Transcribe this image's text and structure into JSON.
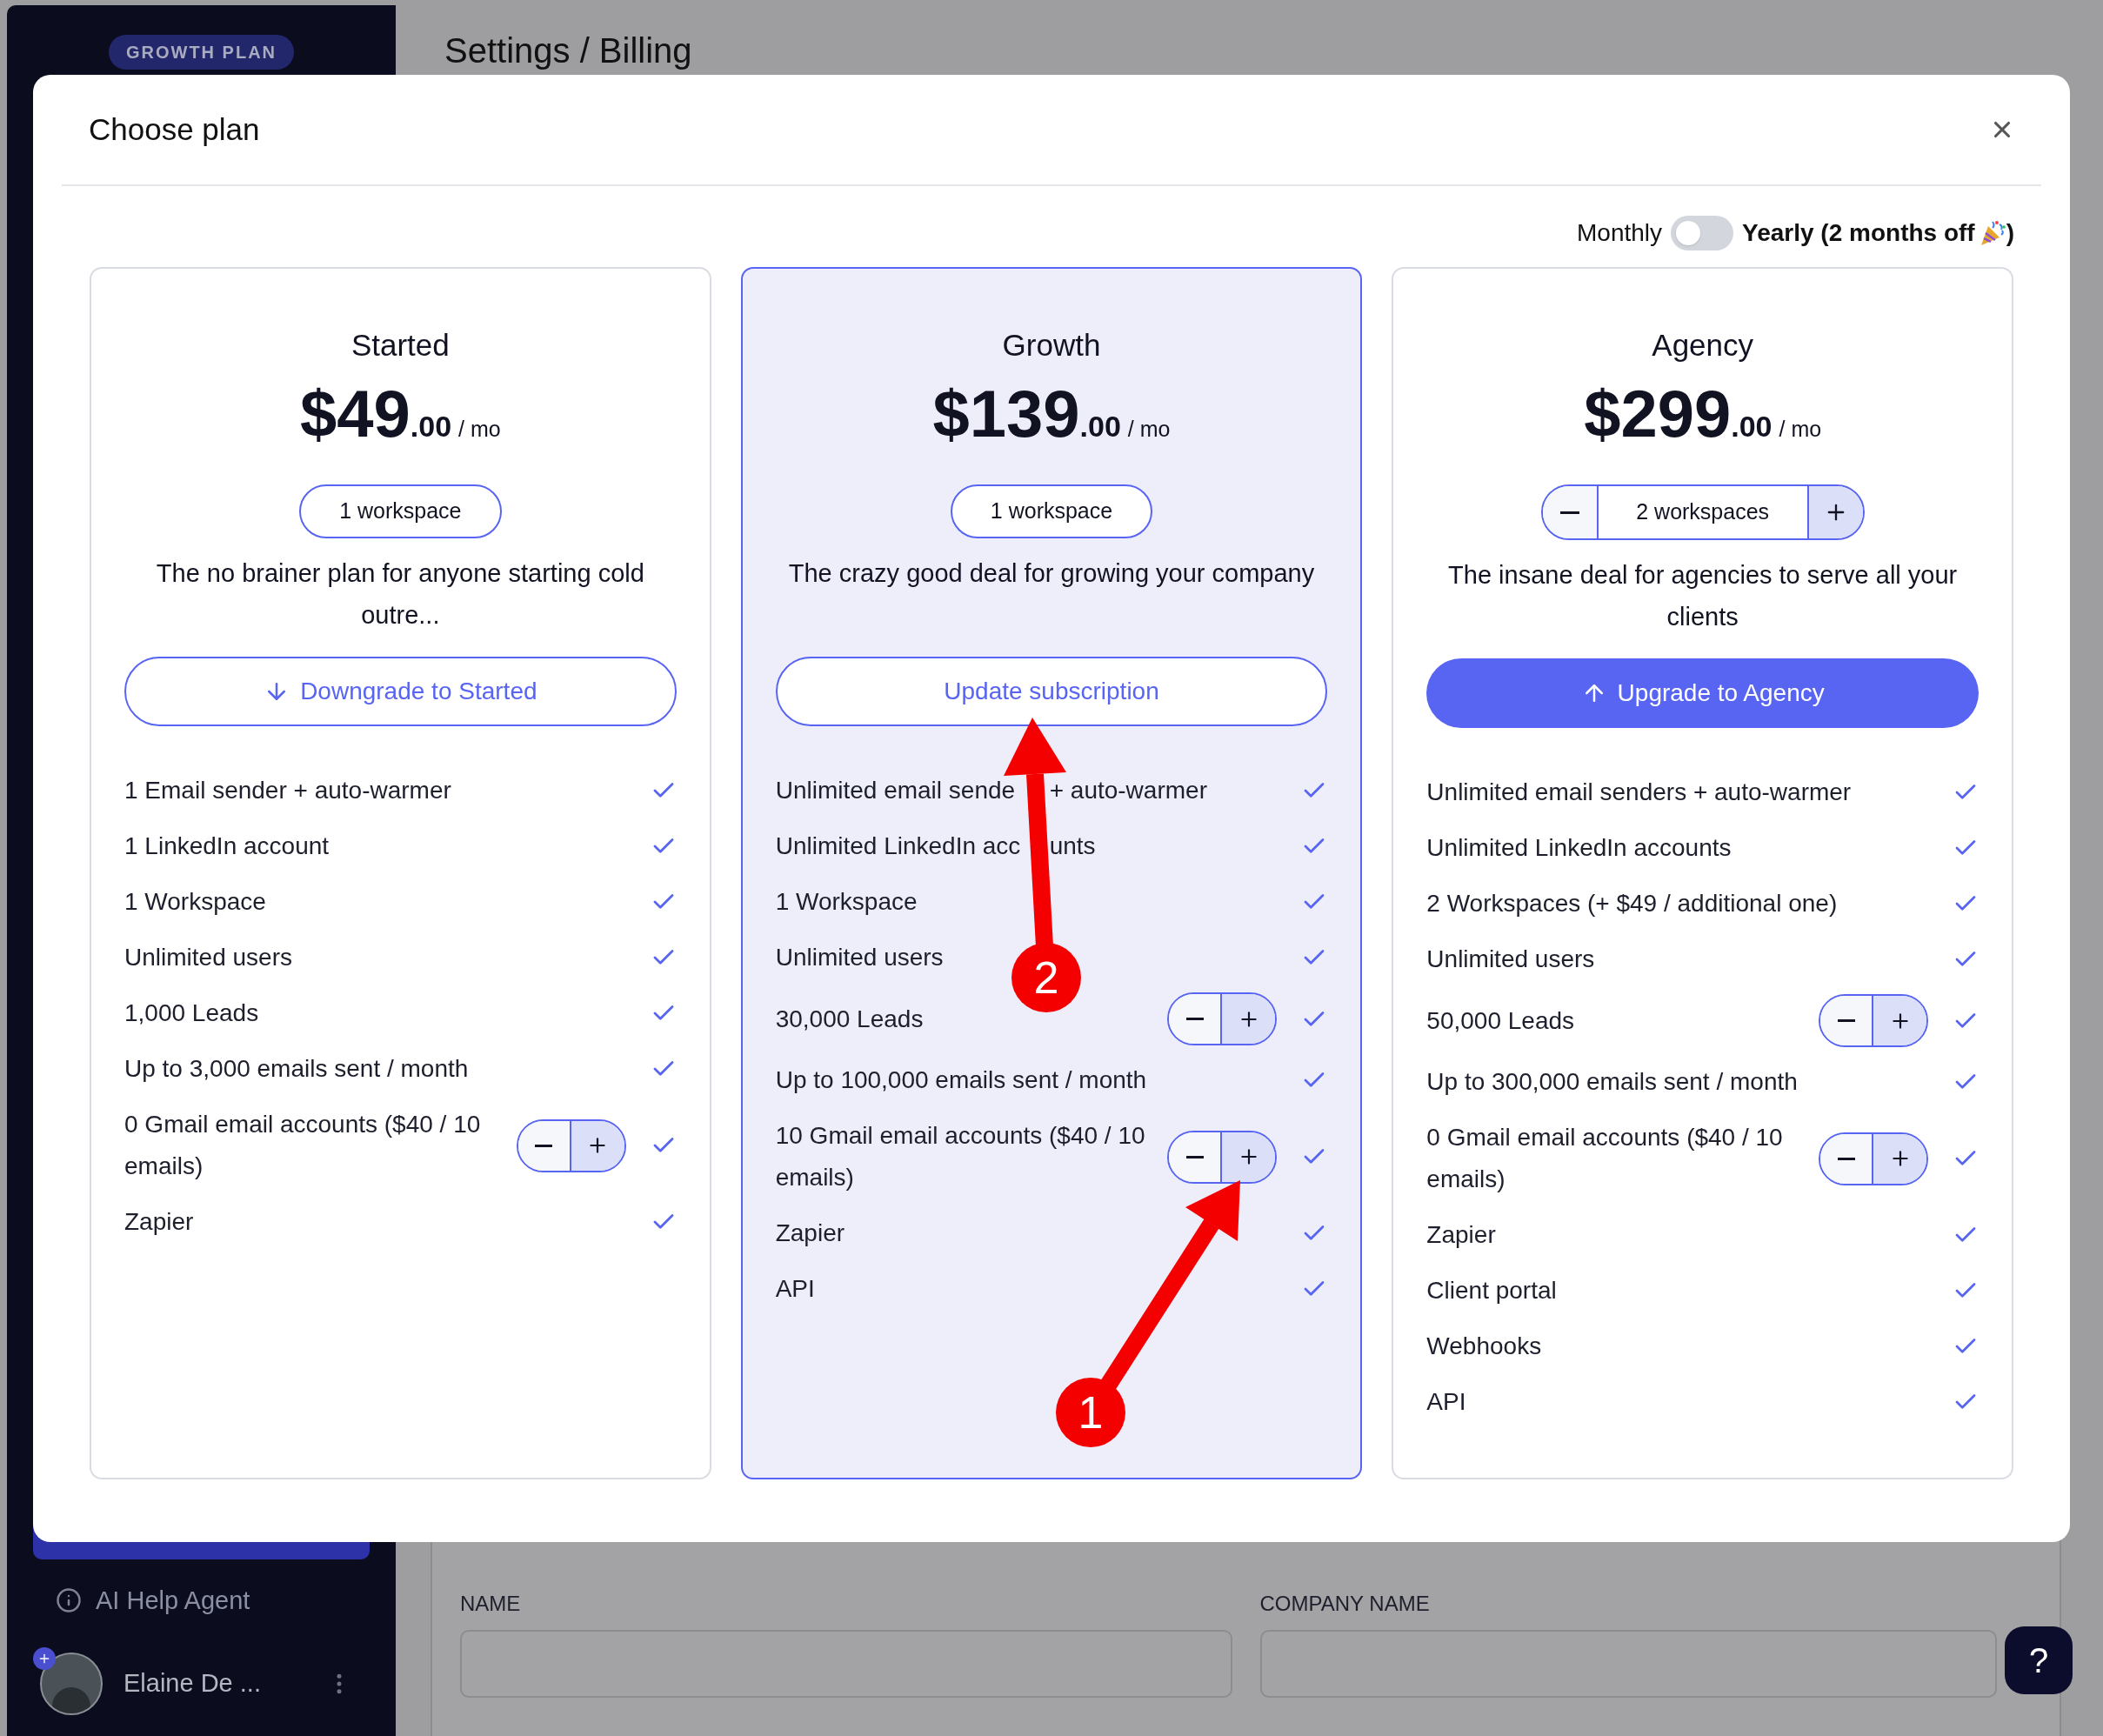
{
  "sidebar": {
    "plan_badge": "GROWTH PLAN",
    "help_agent": "AI Help Agent",
    "user_name": "Elaine De ..."
  },
  "page": {
    "breadcrumb": "Settings / Billing",
    "fields": [
      {
        "label": "NAME"
      },
      {
        "label": "COMPANY NAME"
      }
    ],
    "help_button": "?"
  },
  "modal": {
    "title": "Choose plan",
    "billing_toggle": {
      "monthly": "Monthly",
      "yearly": "Yearly (2 months off",
      "yearly_end": ")",
      "on": false
    },
    "plans": [
      {
        "name": "Started",
        "price": "$49",
        "cents": ".00",
        "period": "/ mo",
        "selected": false,
        "workspace": {
          "kind": "pill",
          "label": "1 workspace"
        },
        "description": "The no brainer plan for anyone starting cold outre...",
        "cta": {
          "kind": "downgrade",
          "label": "Downgrade to Started"
        },
        "features": [
          {
            "text": "1 Email sender + auto-warmer",
            "kind": "plain"
          },
          {
            "text": "1 LinkedIn account",
            "kind": "plain"
          },
          {
            "text": "1 Workspace",
            "kind": "plain"
          },
          {
            "text": "Unlimited users",
            "kind": "plain"
          },
          {
            "text": "1,000 Leads",
            "kind": "plain"
          },
          {
            "text": "Up to 3,000 emails sent / month",
            "kind": "plain"
          },
          {
            "text": "0 Gmail email accounts ($40 / 10 emails)",
            "kind": "stepper"
          },
          {
            "text": "Zapier",
            "kind": "plain"
          }
        ]
      },
      {
        "name": "Growth",
        "price": "$139",
        "cents": ".00",
        "period": "/ mo",
        "selected": true,
        "workspace": {
          "kind": "pill",
          "label": "1 workspace"
        },
        "description": "The crazy good deal for growing your company",
        "cta": {
          "kind": "current",
          "label": "Update subscription"
        },
        "features": [
          {
            "text": "Unlimited email sende",
            "text_after": "+ auto-warmer",
            "kind": "obscured"
          },
          {
            "text": "Unlimited LinkedIn acc",
            "text_after": "unts",
            "kind": "obscured"
          },
          {
            "text": "1 Workspace",
            "kind": "plain"
          },
          {
            "text": "Unlimited users",
            "kind": "plain"
          },
          {
            "text": "30,000 Leads",
            "kind": "stepper"
          },
          {
            "text": "Up to 100,000 emails sent / month",
            "kind": "plain"
          },
          {
            "text": "10 Gmail email accounts ($40 / 10 emails)",
            "kind": "stepper"
          },
          {
            "text": "Zapier",
            "kind": "plain"
          },
          {
            "text": "API",
            "kind": "plain"
          }
        ]
      },
      {
        "name": "Agency",
        "price": "$299",
        "cents": ".00",
        "period": "/ mo",
        "selected": false,
        "workspace": {
          "kind": "stepper",
          "label": "2 workspaces"
        },
        "description": "The insane deal for agencies to serve all your clients",
        "cta": {
          "kind": "upgrade",
          "label": "Upgrade to Agency"
        },
        "features": [
          {
            "text": "Unlimited email senders + auto-warmer",
            "kind": "plain"
          },
          {
            "text": "Unlimited LinkedIn accounts",
            "kind": "plain"
          },
          {
            "text": "2 Workspaces (+ $49 / additional one)",
            "kind": "plain"
          },
          {
            "text": "Unlimited users",
            "kind": "plain"
          },
          {
            "text": "50,000 Leads",
            "kind": "stepper"
          },
          {
            "text": "Up to 300,000 emails sent / month",
            "kind": "plain"
          },
          {
            "text": "0 Gmail email accounts ($40 / 10 emails)",
            "kind": "stepper"
          },
          {
            "text": "Zapier",
            "kind": "plain"
          },
          {
            "text": "Client portal",
            "kind": "plain"
          },
          {
            "text": "Webhooks",
            "kind": "plain"
          },
          {
            "text": "API",
            "kind": "plain"
          }
        ]
      }
    ]
  },
  "annotations": [
    {
      "label": "1"
    },
    {
      "label": "2"
    }
  ]
}
